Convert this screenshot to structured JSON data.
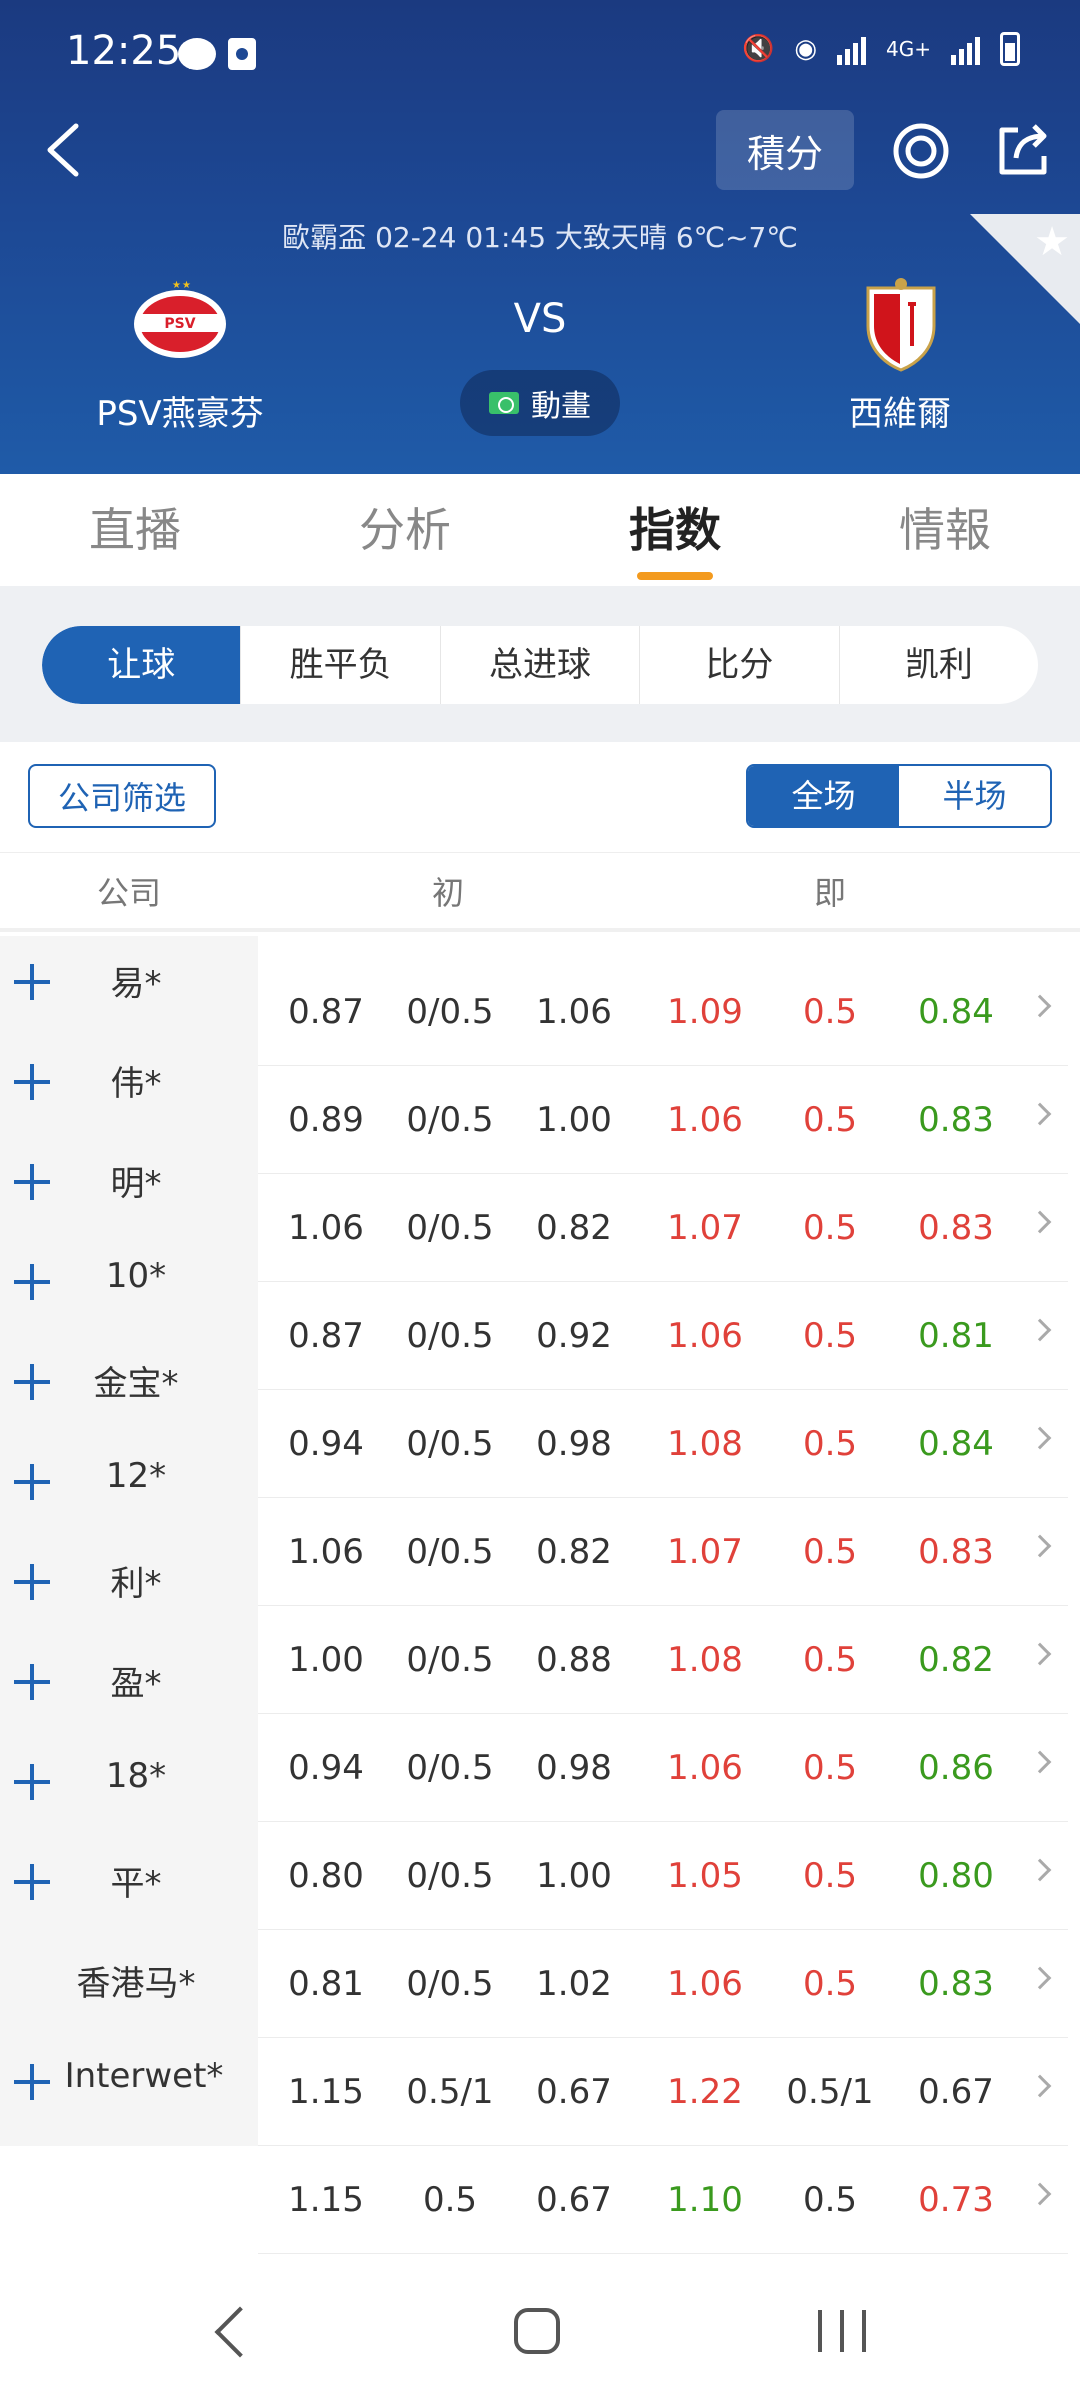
{
  "status_bar": {
    "time": "12:25",
    "network": "4G+"
  },
  "header": {
    "points_label": "積分",
    "match_info": "歐霸盃    02-24 01:45    大致天晴 6℃~7℃",
    "home_team": "PSV燕豪芬",
    "away_team": "西維爾",
    "vs": "VS",
    "anim_label": "動畫",
    "home_logo_text": "PSV"
  },
  "main_tabs": [
    "直播",
    "分析",
    "指数",
    "情報"
  ],
  "active_main_tab": "指数",
  "sub_tabs": [
    "让球",
    "胜平负",
    "总进球",
    "比分",
    "凯利"
  ],
  "active_sub_tab": "让球",
  "filter": {
    "company_filter": "公司筛选",
    "period": [
      "全场",
      "半场"
    ],
    "active_period": "全场"
  },
  "table": {
    "headers": {
      "company": "公司",
      "initial": "初",
      "live": "即"
    },
    "colors": {
      "up": "#e0413a",
      "down": "#3a9a1e",
      "neutral": "#333333"
    },
    "companies": [
      "易*",
      "伟*",
      "明*",
      "10*",
      "金宝*",
      "12*",
      "利*",
      "盈*",
      "18*",
      "平*",
      "香港马*",
      "Interwet*"
    ],
    "rows": [
      {
        "init": [
          "0.87",
          "0/0.5",
          "1.06"
        ],
        "live": [
          "1.09",
          "0.5",
          "0.84"
        ],
        "live_colors": [
          "up",
          "up",
          "down"
        ]
      },
      {
        "init": [
          "0.89",
          "0/0.5",
          "1.00"
        ],
        "live": [
          "1.06",
          "0.5",
          "0.83"
        ],
        "live_colors": [
          "up",
          "up",
          "down"
        ]
      },
      {
        "init": [
          "1.06",
          "0/0.5",
          "0.82"
        ],
        "live": [
          "1.07",
          "0.5",
          "0.83"
        ],
        "live_colors": [
          "up",
          "up",
          "up"
        ]
      },
      {
        "init": [
          "0.87",
          "0/0.5",
          "0.92"
        ],
        "live": [
          "1.06",
          "0.5",
          "0.81"
        ],
        "live_colors": [
          "up",
          "up",
          "down"
        ]
      },
      {
        "init": [
          "0.94",
          "0/0.5",
          "0.98"
        ],
        "live": [
          "1.08",
          "0.5",
          "0.84"
        ],
        "live_colors": [
          "up",
          "up",
          "down"
        ]
      },
      {
        "init": [
          "1.06",
          "0/0.5",
          "0.82"
        ],
        "live": [
          "1.07",
          "0.5",
          "0.83"
        ],
        "live_colors": [
          "up",
          "up",
          "up"
        ]
      },
      {
        "init": [
          "1.00",
          "0/0.5",
          "0.88"
        ],
        "live": [
          "1.08",
          "0.5",
          "0.82"
        ],
        "live_colors": [
          "up",
          "up",
          "down"
        ]
      },
      {
        "init": [
          "0.94",
          "0/0.5",
          "0.98"
        ],
        "live": [
          "1.06",
          "0.5",
          "0.86"
        ],
        "live_colors": [
          "up",
          "up",
          "down"
        ]
      },
      {
        "init": [
          "0.80",
          "0/0.5",
          "1.00"
        ],
        "live": [
          "1.05",
          "0.5",
          "0.80"
        ],
        "live_colors": [
          "up",
          "up",
          "down"
        ]
      },
      {
        "init": [
          "0.81",
          "0/0.5",
          "1.02"
        ],
        "live": [
          "1.06",
          "0.5",
          "0.83"
        ],
        "live_colors": [
          "up",
          "up",
          "down"
        ]
      },
      {
        "init": [
          "1.15",
          "0.5/1",
          "0.67"
        ],
        "live": [
          "1.22",
          "0.5/1",
          "0.67"
        ],
        "live_colors": [
          "up",
          "neutral",
          "neutral"
        ]
      },
      {
        "init": [
          "1.15",
          "0.5",
          "0.67"
        ],
        "live": [
          "1.10",
          "0.5",
          "0.73"
        ],
        "live_colors": [
          "down",
          "neutral",
          "up"
        ]
      }
    ]
  }
}
